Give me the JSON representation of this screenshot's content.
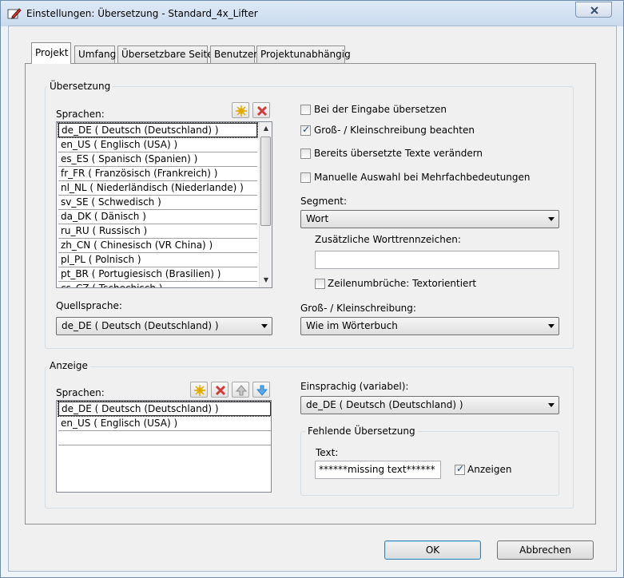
{
  "window": {
    "title": "Einstellungen: Übersetzung - Standard_4x_Lifter"
  },
  "tabs": [
    {
      "label": "Projekt",
      "active": true
    },
    {
      "label": "Umfang"
    },
    {
      "label": "Übersetzbare Seiten"
    },
    {
      "label": "Benutzer"
    },
    {
      "label": "Projektunabhängig"
    }
  ],
  "translation": {
    "group_label": "Übersetzung",
    "languages_label": "Sprachen:",
    "languages": [
      "de_DE ( Deutsch (Deutschland) )",
      "en_US ( Englisch (USA) )",
      "es_ES ( Spanisch (Spanien) )",
      "fr_FR ( Französisch (Frankreich) )",
      "nl_NL ( Niederländisch (Niederlande) )",
      "sv_SE ( Schwedisch )",
      "da_DK ( Dänisch )",
      "ru_RU ( Russisch )",
      "zh_CN ( Chinesisch (VR China) )",
      "pl_PL ( Polnisch )",
      "pt_BR ( Portugiesisch (Brasilien) )",
      "cs_CZ ( Tschechisch )"
    ],
    "source_language_label": "Quellsprache:",
    "source_language_value": "de_DE ( Deutsch (Deutschland) )",
    "options": [
      {
        "label": "Bei der Eingabe übersetzen",
        "checked": false
      },
      {
        "label": "Groß- / Kleinschreibung beachten",
        "checked": true
      },
      {
        "label": "Bereits übersetzte Texte verändern",
        "checked": false
      },
      {
        "label": "Manuelle Auswahl bei Mehrfachbedeutungen",
        "checked": false
      }
    ],
    "segment_label": "Segment:",
    "segment_value": "Wort",
    "extra_separators_label": "Zusätzliche Worttrennzeichen:",
    "extra_separators_value": "",
    "line_breaks_label": "Zeilenumbrüche: Textorientiert",
    "line_breaks_checked": false,
    "case_label": "Groß- / Kleinschreibung:",
    "case_value": "Wie im Wörterbuch"
  },
  "display": {
    "group_label": "Anzeige",
    "languages_label": "Sprachen:",
    "languages": [
      "de_DE ( Deutsch (Deutschland) )",
      "en_US ( Englisch (USA) )"
    ],
    "monolingual_label": "Einsprachig (variabel):",
    "monolingual_value": "de_DE ( Deutsch (Deutschland) )",
    "missing_group_label": "Fehlende Übersetzung",
    "text_label": "Text:",
    "text_value": "******missing text******",
    "show_label": "Anzeigen",
    "show_checked": true
  },
  "buttons": {
    "ok": "OK",
    "cancel": "Abbrechen"
  },
  "colors": {
    "accent": "#3c7fb1",
    "delete_icon": "#d23a3a",
    "new_icon": "#f3c623",
    "move_icon": "#2f86d6"
  },
  "icons": [
    "title-app-icon",
    "new-icon",
    "delete-icon",
    "move-up-icon",
    "move-down-icon",
    "close-icon"
  ]
}
